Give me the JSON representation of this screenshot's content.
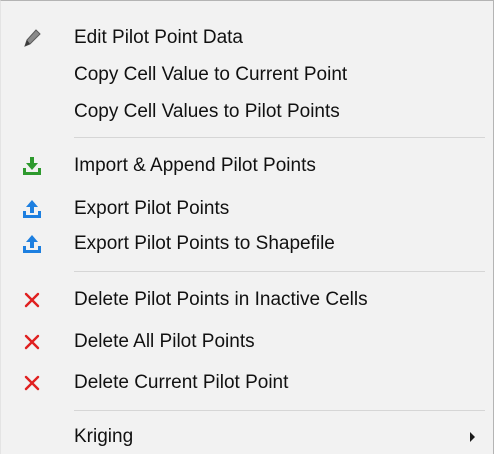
{
  "menu": {
    "groups": [
      {
        "items": [
          {
            "label": "Edit Pilot Point Data",
            "icon": "pencil-icon"
          },
          {
            "label": "Copy Cell Value to Current Point"
          },
          {
            "label": "Copy Cell Values to Pilot Points"
          }
        ]
      },
      {
        "items": [
          {
            "label": "Import & Append Pilot Points",
            "icon": "import-arrow-icon"
          },
          {
            "label": "Export Pilot Points",
            "icon": "export-arrow-icon"
          },
          {
            "label": "Export Pilot Points to Shapefile",
            "icon": "export-arrow-icon"
          }
        ]
      },
      {
        "items": [
          {
            "label": "Delete Pilot Points in Inactive Cells",
            "icon": "delete-x-icon"
          },
          {
            "label": "Delete All Pilot Points",
            "icon": "delete-x-icon"
          },
          {
            "label": "Delete Current Pilot Point",
            "icon": "delete-x-icon"
          }
        ]
      },
      {
        "items": [
          {
            "label": "Kriging",
            "submenu": true
          }
        ]
      }
    ]
  },
  "colors": {
    "menu_background": "#f2f2f2",
    "import_icon": "#2e9a2e",
    "export_icon": "#1d7fe0",
    "delete_icon": "#e02020"
  }
}
